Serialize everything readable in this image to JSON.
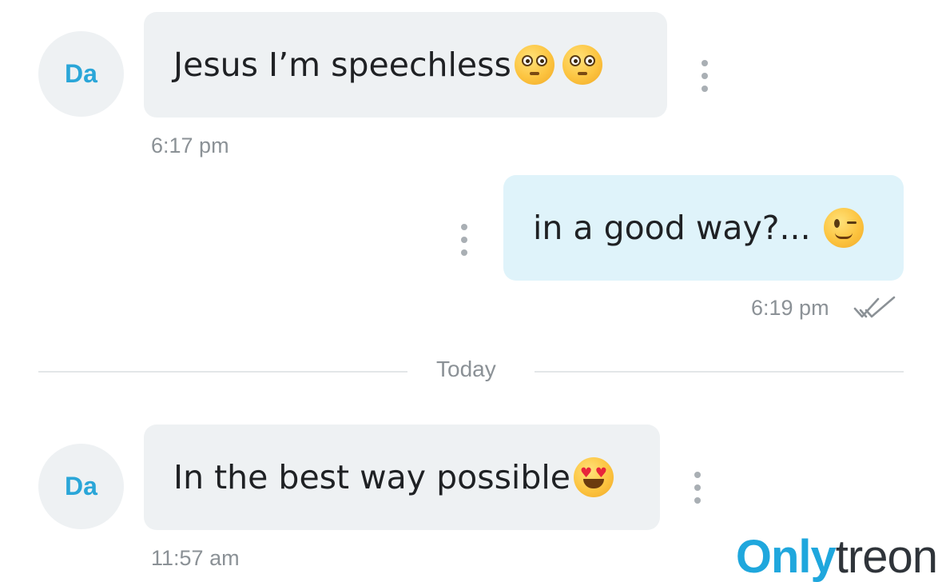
{
  "messages": [
    {
      "direction": "incoming",
      "avatar_initials": "Da",
      "text": "Jesus I’m speechless",
      "emojis": [
        "flushed-face",
        "flushed-face"
      ],
      "time": "6:17 pm"
    },
    {
      "direction": "outgoing",
      "text": "in a good way?...",
      "emojis": [
        "winking-face"
      ],
      "time": "6:19 pm",
      "status": "read-double-check"
    },
    {
      "direction": "incoming",
      "avatar_initials": "Da",
      "text": "In the best way possible",
      "emojis": [
        "heart-eyes-face"
      ],
      "time": "11:57 am"
    }
  ],
  "date_divider": {
    "label": "Today"
  },
  "watermark": {
    "part1": "Only",
    "part2": "treon"
  },
  "colors": {
    "incoming_bubble": "#eef1f3",
    "outgoing_bubble": "#dff3fa",
    "avatar_text": "#2aa6d8",
    "watermark_accent": "#1fa7dd"
  }
}
